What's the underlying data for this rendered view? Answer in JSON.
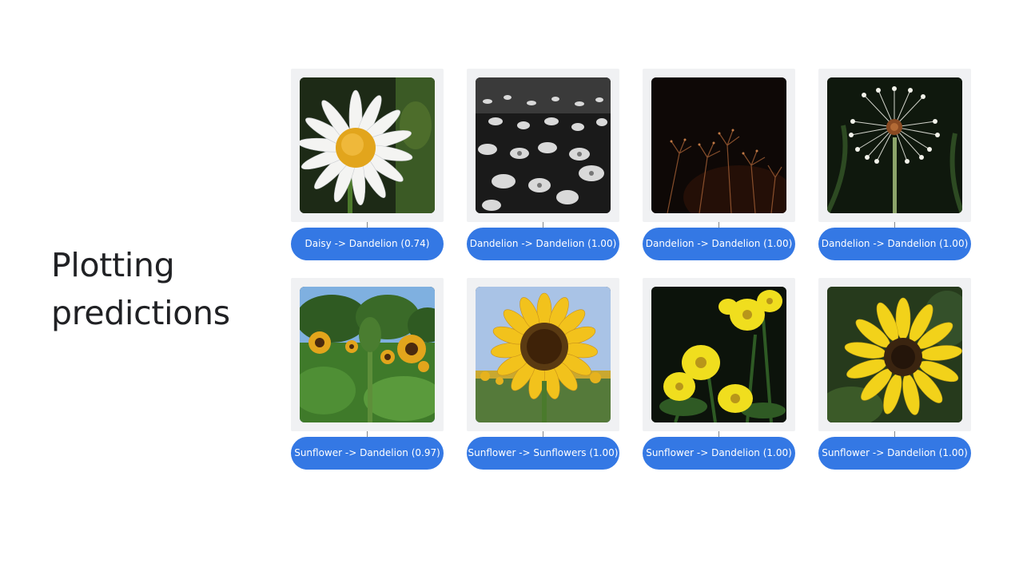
{
  "slide": {
    "title_line1": "Plotting",
    "title_line2": "predictions"
  },
  "predictions": [
    {
      "label": "Daisy -> Dandelion (0.74)",
      "image": "white-daisy-photo"
    },
    {
      "label": "Dandelion -> Dandelion (1.00)",
      "image": "black-and-white-dandelion-field-photo"
    },
    {
      "label": "Dandelion -> Dandelion (1.00)",
      "image": "dark-dandelion-seeds-photo"
    },
    {
      "label": "Dandelion -> Dandelion (1.00)",
      "image": "dandelion-seed-head-photo"
    },
    {
      "label": "Sunflower -> Dandelion (0.97)",
      "image": "sunflower-field-photo"
    },
    {
      "label": "Sunflower -> Sunflowers (1.00)",
      "image": "large-sunflower-photo"
    },
    {
      "label": "Sunflower -> Dandelion (1.00)",
      "image": "yellow-flowers-photo"
    },
    {
      "label": "Sunflower -> Dandelion (1.00)",
      "image": "single-sunflower-photo"
    }
  ],
  "colors": {
    "pill": "#3478e4",
    "frame": "#f0f1f3",
    "title": "#202124"
  }
}
